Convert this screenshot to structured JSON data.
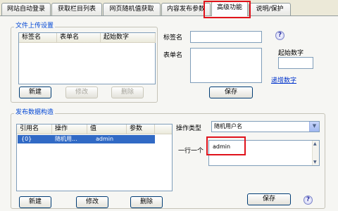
{
  "tabs": [
    {
      "label": "网站自动登录"
    },
    {
      "label": "获取栏目列表"
    },
    {
      "label": "网页随机值获取"
    },
    {
      "label": "内容发布参数"
    },
    {
      "label": "高级功能"
    },
    {
      "label": "说明/保护"
    }
  ],
  "active_tab": "高级功能",
  "upload": {
    "title": "文件上传设置",
    "columns": [
      "标签名",
      "表单名",
      "起始数字"
    ],
    "buttons": {
      "new": "新建",
      "edit": "修改",
      "delete": "删除",
      "save": "保存"
    },
    "tag_label": "标签名",
    "form_label": "表单名",
    "start_label": "起始数字",
    "increment_link": "递增数字",
    "help": "?"
  },
  "publish": {
    "title": "发布数据构造",
    "columns": [
      "引用名",
      "操作",
      "值",
      "参数"
    ],
    "rows": [
      {
        "ref": "{0}",
        "op": "随机用...",
        "value": "admin",
        "param": ""
      }
    ],
    "op_type_label": "操作类型",
    "op_type_value": "随机用户名",
    "one_per_line_label": "一行一个",
    "textarea_value": "admin",
    "buttons": {
      "new": "新建",
      "edit": "修改",
      "delete": "删除",
      "save": "保存"
    },
    "help": "?"
  },
  "colors": {
    "highlight": "#e0121b",
    "selection": "#316ac5",
    "group_title": "#0046d5",
    "link": "#0033cc"
  }
}
